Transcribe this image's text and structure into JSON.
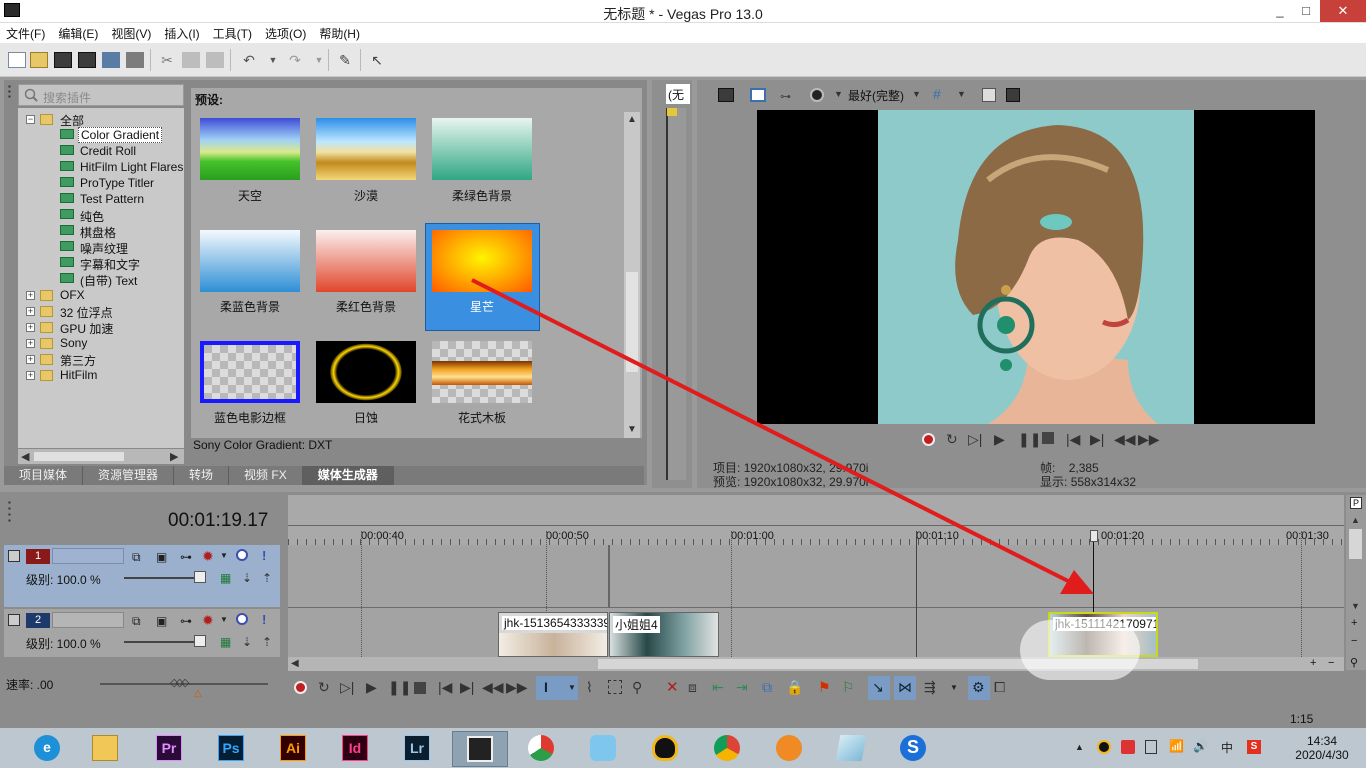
{
  "window": {
    "title": "无标题 * - Vegas Pro 13.0",
    "min": "_",
    "max": "□",
    "close": "✕"
  },
  "menu": [
    "文件(F)",
    "编辑(E)",
    "视图(V)",
    "插入(I)",
    "工具(T)",
    "选项(O)",
    "帮助(H)"
  ],
  "explorer": {
    "search_placeholder": "搜索插件",
    "tree": {
      "root": "全部",
      "children": [
        "Color Gradient",
        "Credit Roll",
        "HitFilm Light Flares",
        "ProType Titler",
        "Test Pattern",
        "纯色",
        "棋盘格",
        "噪声纹理",
        "字幕和文字",
        "(自带) Text"
      ],
      "folders": [
        "OFX",
        "32 位浮点",
        "GPU 加速",
        "Sony",
        "第三方",
        "HitFilm"
      ],
      "selected": "Color Gradient"
    },
    "presets_header": "预设:",
    "presets": [
      "天空",
      "沙漠",
      "柔绿色背景",
      "柔蓝色背景",
      "柔红色背景",
      "星芒",
      "蓝色电影边框",
      "日蚀",
      "花式木板"
    ],
    "selected_preset": "星芒",
    "status": "Sony Color Gradient: DXT",
    "tabs": [
      "项目媒体",
      "资源管理器",
      "转场",
      "视频 FX",
      "媒体生成器"
    ],
    "active_tab": "媒体生成器"
  },
  "trimmer": {
    "tab": "(无"
  },
  "preview": {
    "quality": "最好(完整)",
    "project_label": "项目:",
    "project_value": "1920x1080x32, 29.970i",
    "preview_label": "预览:",
    "preview_value": "1920x1080x32, 29.970i",
    "frame_label": "帧:",
    "frame_value": "2,385",
    "display_label": "显示:",
    "display_value": "558x314x32"
  },
  "timeline": {
    "timecode": "00:01:19.17",
    "ruler": [
      "00:00:40",
      "00:00:50",
      "00:01:00",
      "00:01:10",
      "00:01:20",
      "00:01:30"
    ],
    "tracks": [
      {
        "num": "1",
        "level": "级别: 100.0 %"
      },
      {
        "num": "2",
        "level": "级别: 100.0 %"
      }
    ],
    "clips": [
      {
        "label": "jhk-1513654333339"
      },
      {
        "label": "小姐姐4"
      },
      {
        "label": "jhk-1511142170971"
      }
    ],
    "rate": "速率: .00",
    "time_end": "1:15"
  },
  "taskbar": {
    "apps": [
      {
        "name": "edge",
        "text": "e"
      },
      {
        "name": "file-explorer",
        "text": ""
      },
      {
        "name": "premiere",
        "text": "Pr"
      },
      {
        "name": "photoshop",
        "text": "Ps"
      },
      {
        "name": "illustrator",
        "text": "Ai"
      },
      {
        "name": "indesign",
        "text": "Id"
      },
      {
        "name": "lightroom",
        "text": "Lr"
      },
      {
        "name": "vegas",
        "text": ""
      },
      {
        "name": "app-9",
        "text": ""
      },
      {
        "name": "app-10",
        "text": ""
      },
      {
        "name": "qq",
        "text": ""
      },
      {
        "name": "chrome",
        "text": ""
      },
      {
        "name": "app-13",
        "text": ""
      },
      {
        "name": "app-14",
        "text": ""
      },
      {
        "name": "sogou",
        "text": "S"
      }
    ],
    "time": "14:34",
    "date": "2020/4/30",
    "ime": "中"
  },
  "colors": {
    "accent": "#3a8fe0",
    "arrow": "#e01c1c"
  }
}
